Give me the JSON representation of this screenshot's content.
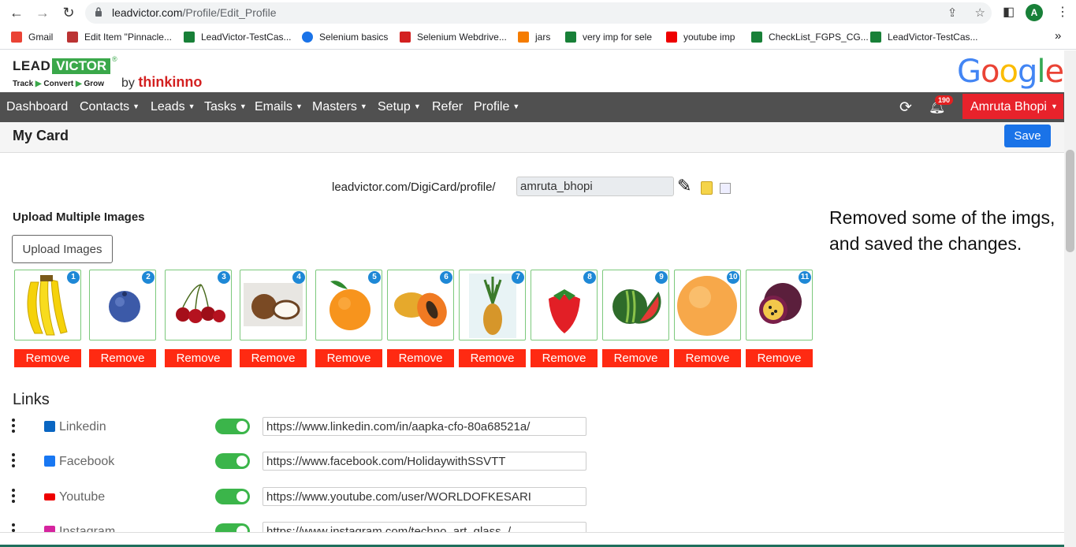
{
  "browser": {
    "url_host": "leadvictor.com",
    "url_path": "/Profile/Edit_Profile",
    "avatar_letter": "A",
    "bookmarks": [
      {
        "label": "Gmail",
        "color": "#ea4335"
      },
      {
        "label": "Edit Item \"Pinnacle...",
        "color": "#b33"
      },
      {
        "label": "LeadVictor-TestCas...",
        "color": "#188038"
      },
      {
        "label": "Selenium basics",
        "color": "#1a73e8"
      },
      {
        "label": "Selenium Webdrive...",
        "color": "#d32020"
      },
      {
        "label": "jars",
        "color": "#f57c00"
      },
      {
        "label": "very imp for sele",
        "color": "#188038"
      },
      {
        "label": "youtube imp",
        "color": "#e00"
      },
      {
        "label": "CheckList_FGPS_CG...",
        "color": "#188038"
      },
      {
        "label": "LeadVictor-TestCas...",
        "color": "#188038"
      }
    ],
    "more_bookmarks": "»"
  },
  "header": {
    "logo_lead": "LEAD",
    "logo_victor": "VICTOR",
    "tagline_track": "Track",
    "tagline_convert": "Convert",
    "tagline_grow": "Grow",
    "by_text": "by",
    "by_brand": "thinkinno",
    "google_logo": "Google"
  },
  "nav": {
    "items": [
      "Dashboard",
      "Contacts",
      "Leads",
      "Tasks",
      "Emails",
      "Masters",
      "Setup",
      "Refer",
      "Profile"
    ],
    "notification_count": "190",
    "user_name": "Amruta Bhopi"
  },
  "card": {
    "title": "My Card",
    "save_label": "Save",
    "profile_url_prefix": "leadvictor.com/DigiCard/profile/",
    "profile_slug": "amruta_bhopi"
  },
  "upload": {
    "title": "Upload Multiple Images",
    "button_label": "Upload Images",
    "remove_label": "Remove",
    "images": [
      {
        "num": "1",
        "icon": "banana"
      },
      {
        "num": "2",
        "icon": "blueberry"
      },
      {
        "num": "3",
        "icon": "cherries"
      },
      {
        "num": "4",
        "icon": "coconut"
      },
      {
        "num": "5",
        "icon": "orange"
      },
      {
        "num": "6",
        "icon": "papaya"
      },
      {
        "num": "7",
        "icon": "pineapple"
      },
      {
        "num": "8",
        "icon": "strawberry"
      },
      {
        "num": "9",
        "icon": "watermelon"
      },
      {
        "num": "10",
        "icon": "apricot"
      },
      {
        "num": "11",
        "icon": "passion-fruit"
      }
    ]
  },
  "note": "Removed some of the imgs, and saved the changes.",
  "links": {
    "title": "Links",
    "items": [
      {
        "label": "Linkedin",
        "url": "https://www.linkedin.com/in/aapka-cfo-80a68521a/",
        "color": "#0a66c2"
      },
      {
        "label": "Facebook",
        "url": "https://www.facebook.com/HolidaywithSSVTT",
        "color": "#1877f2"
      },
      {
        "label": "Youtube",
        "url": "https://www.youtube.com/user/WORLDOFKESARI",
        "color": "#e00"
      },
      {
        "label": "Instagram",
        "url": "https://www.instagram.com/techno_art_glass_/",
        "color": "#d6249f"
      }
    ]
  }
}
